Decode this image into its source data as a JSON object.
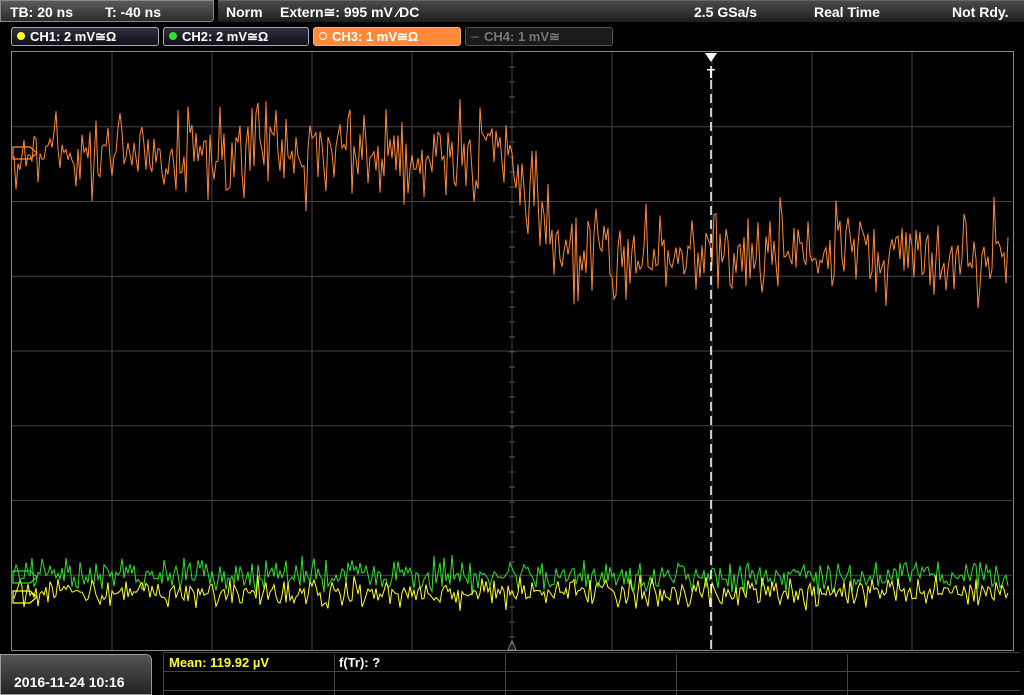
{
  "header": {
    "timebase": "TB: 20 ns",
    "trigger_time": "T: -40 ns",
    "mode": "Norm",
    "trigger": "Extern≅: 995 mV ⁄DC",
    "sample_rate": "2.5 GSa/s",
    "acq_mode": "Real Time",
    "status": "Not Rdy."
  },
  "channels": [
    {
      "label": "CH1: 2 mV≅Ω",
      "color": "#ffff30",
      "state": "on"
    },
    {
      "label": "CH2: 2 mV≅Ω",
      "color": "#30e030",
      "state": "on"
    },
    {
      "label": "CH3: 1 mV≅Ω",
      "color": "#ff8a3c",
      "state": "active"
    },
    {
      "label": "CH4: 1 mV≅",
      "color": "#777777",
      "state": "off"
    }
  ],
  "footer": {
    "datetime": "2016-11-24 10:16",
    "mean": "Mean: 119.92 µV",
    "freq": "f(Tr): ?"
  },
  "trigger_marker": "T",
  "colors": {
    "grid": "#555555",
    "trace_ch1": "#ffff30",
    "trace_ch2": "#30e030",
    "trace_ch3": "#ff8a3c"
  }
}
